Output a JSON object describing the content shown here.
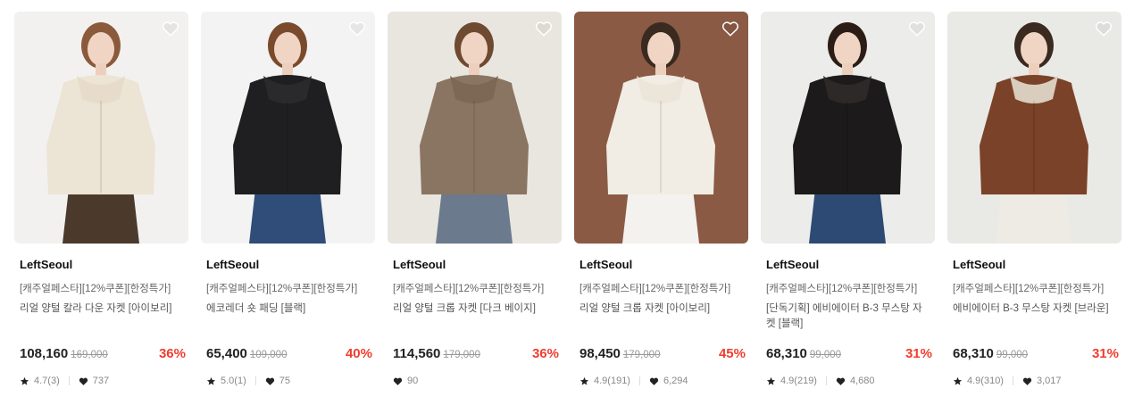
{
  "colors": {
    "discount": "#f03c2e",
    "brand_text": "#111111",
    "muted": "#999999"
  },
  "products": [
    {
      "brand": "LeftSeoul",
      "tags": "[캐주얼페스타][12%쿠폰][한정특가]",
      "name": "리얼 양털 칼라 다운 자켓 [아이보리]",
      "price": "108,160",
      "original_price": "169,000",
      "discount": "36%",
      "rating": "4.7(3)",
      "likes": "737",
      "image": {
        "bg": "#f2f1ef",
        "coat": "#ece4d4",
        "collar": "#e7dccb",
        "bottom": "#4b3a2b",
        "hair": "#8a5a3b"
      }
    },
    {
      "brand": "LeftSeoul",
      "tags": "[캐주얼페스타][12%쿠폰][한정특가]",
      "name": "에코레더 숏 패딩 [블랙]",
      "price": "65,400",
      "original_price": "109,000",
      "discount": "40%",
      "rating": "5.0(1)",
      "likes": "75",
      "image": {
        "bg": "#f3f3f3",
        "coat": "#1f1f22",
        "collar": "#2a2a2d",
        "bottom": "#2f4d78",
        "hair": "#7a4a2d"
      }
    },
    {
      "brand": "LeftSeoul",
      "tags": "[캐주얼페스타][12%쿠폰][한정특가]",
      "name": "리얼 양털 크롭 자켓 [다크 베이지]",
      "price": "114,560",
      "original_price": "179,000",
      "discount": "36%",
      "rating": "",
      "likes": "90",
      "image": {
        "bg": "#e9e6e0",
        "coat": "#8a7562",
        "collar": "#7c6854",
        "bottom": "#6b7a8c",
        "hair": "#6e4a30"
      }
    },
    {
      "brand": "LeftSeoul",
      "tags": "[캐주얼페스타][12%쿠폰][한정특가]",
      "name": "리얼 양털 크롭 자켓 [아이보리]",
      "price": "98,450",
      "original_price": "179,000",
      "discount": "45%",
      "rating": "4.9(191)",
      "likes": "6,294",
      "image": {
        "bg": "#8a5a45",
        "coat": "#f1ede4",
        "collar": "#ece6da",
        "bottom": "#f4f2ee",
        "hair": "#3a2a20"
      }
    },
    {
      "brand": "LeftSeoul",
      "tags": "[캐주얼페스타][12%쿠폰][한정특가]",
      "name": "[단독기획] 에비에이터 B-3 무스탕 자켓 [블랙]",
      "price": "68,310",
      "original_price": "99,000",
      "discount": "31%",
      "rating": "4.9(219)",
      "likes": "4,680",
      "image": {
        "bg": "#ececea",
        "coat": "#1c1a1a",
        "collar": "#2c2928",
        "bottom": "#2c4a74",
        "hair": "#2b1d16"
      }
    },
    {
      "brand": "LeftSeoul",
      "tags": "[캐주얼페스타][12%쿠폰][한정특가]",
      "name": "에비에이터 B-3 무스탕 자켓 [브라운]",
      "price": "68,310",
      "original_price": "99,000",
      "discount": "31%",
      "rating": "4.9(310)",
      "likes": "3,017",
      "image": {
        "bg": "#e9e9e6",
        "coat": "#7a4228",
        "collar": "#d9cdbd",
        "bottom": "#eeeae4",
        "hair": "#3b2a20"
      }
    }
  ]
}
